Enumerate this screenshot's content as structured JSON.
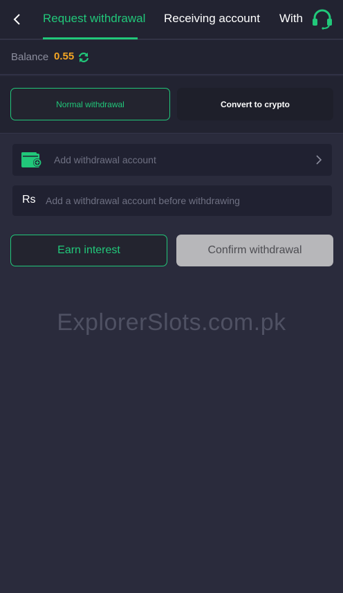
{
  "header": {
    "back_icon": "chevron-left-icon",
    "tabs": [
      {
        "label": "Request withdrawal",
        "active": true
      },
      {
        "label": "Receiving account",
        "active": false
      },
      {
        "label": "With",
        "active": false
      }
    ],
    "support_icon": "headset-icon"
  },
  "balance": {
    "label": "Balance",
    "value": "0.55",
    "refresh_icon": "refresh-icon"
  },
  "modes": {
    "normal_label": "Normal withdrawal",
    "crypto_label": "Convert to crypto"
  },
  "account": {
    "icon": "wallet-icon",
    "label": "Add withdrawal account",
    "chevron_icon": "chevron-right-icon"
  },
  "amount": {
    "currency": "Rs",
    "placeholder": "Add a withdrawal account before withdrawing"
  },
  "actions": {
    "earn_label": "Earn interest",
    "confirm_label": "Confirm withdrawal"
  },
  "watermark": "ExplorerSlots.com.pk",
  "colors": {
    "accent": "#21c87a",
    "balance": "#f5a623",
    "background": "#2a2b3c",
    "panel": "#222331",
    "disabled_button": "#b7b7ba"
  }
}
